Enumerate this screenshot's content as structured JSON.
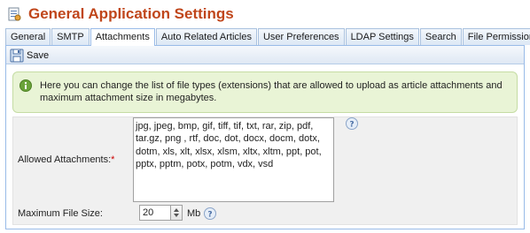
{
  "header": {
    "title": "General Application Settings",
    "icon": "settings-document-icon"
  },
  "tabs": [
    {
      "label": "General",
      "active": false
    },
    {
      "label": "SMTP",
      "active": false
    },
    {
      "label": "Attachments",
      "active": true
    },
    {
      "label": "Auto Related Articles",
      "active": false
    },
    {
      "label": "User Preferences",
      "active": false
    },
    {
      "label": "LDAP Settings",
      "active": false
    },
    {
      "label": "Search",
      "active": false
    },
    {
      "label": "File Permissions",
      "active": false
    }
  ],
  "toolbar": {
    "save_label": "Save",
    "save_icon": "save-icon"
  },
  "info": {
    "text": "Here you can change the list of file types (extensions) that are allowed to upload as article attachments and maximum attachment size in megabytes.",
    "icon": "info-icon",
    "background_color": "#e9f4d6"
  },
  "form": {
    "allowed_label": "Allowed Attachments:",
    "required_mark": "*",
    "allowed_value": "jpg, jpeg, bmp, gif, tiff, tif, txt, rar, zip, pdf, tar.gz, png , rtf, doc, dot, docx, docm, dotx, dotm, xls, xlt, xlsx, xlsm, xltx, xltm, ppt, pot, pptx, pptm, potx, potm, vdx, vsd",
    "max_size_label": "Maximum File Size:",
    "max_size_value": "20",
    "max_size_unit": "Mb",
    "help_icon": "help-icon"
  },
  "colors": {
    "title": "#c0461b",
    "tab_border": "#99bbe8",
    "required": "#cc0000"
  }
}
